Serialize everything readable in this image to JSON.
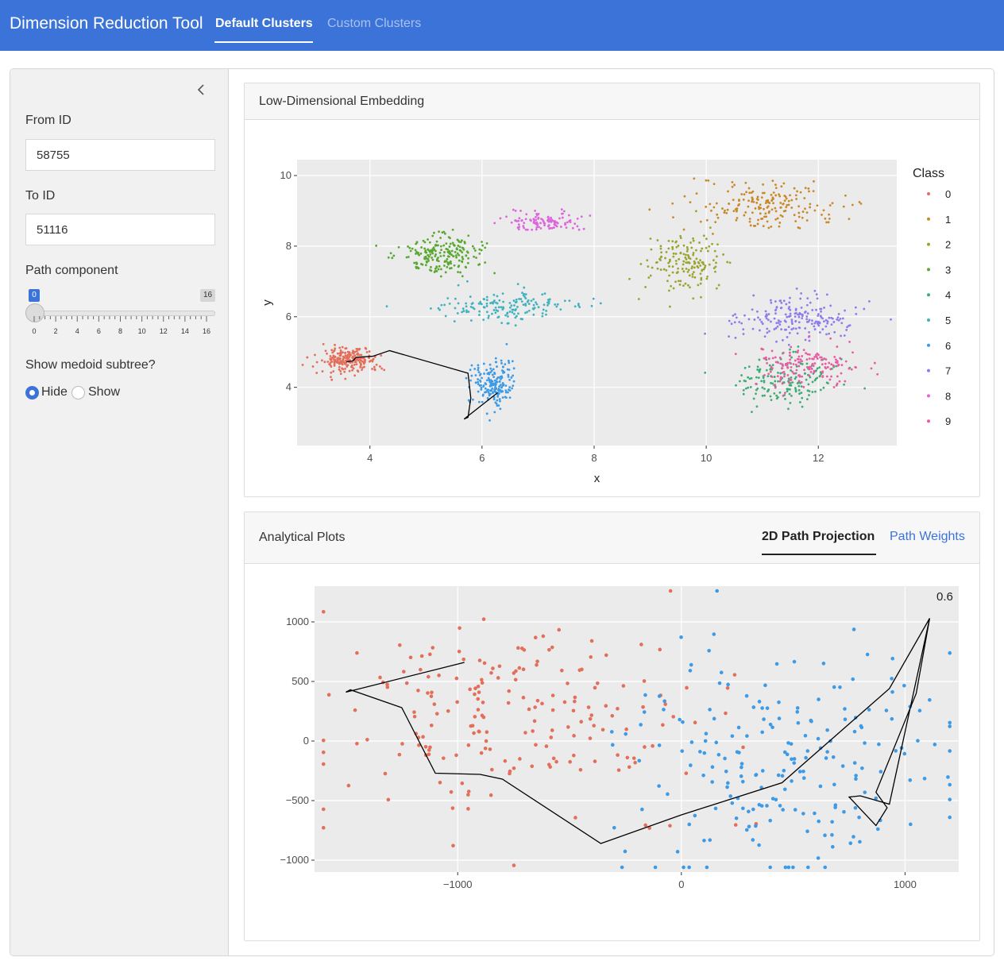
{
  "app": {
    "title": "Dimension Reduction Tool",
    "tabs": [
      {
        "label": "Default Clusters",
        "active": true
      },
      {
        "label": "Custom Clusters",
        "active": false
      }
    ]
  },
  "sidebar": {
    "from_id": {
      "label": "From ID",
      "value": "58755"
    },
    "to_id": {
      "label": "To ID",
      "value": "51116"
    },
    "path_component": {
      "label": "Path component",
      "value": 0,
      "min": 0,
      "max": 16,
      "min_label": "0",
      "max_label": "16",
      "ticks": [
        "0",
        "2",
        "4",
        "6",
        "8",
        "10",
        "12",
        "14",
        "16"
      ]
    },
    "medoid": {
      "label": "Show medoid subtree?",
      "options": [
        "Hide",
        "Show"
      ],
      "selected": "Hide"
    }
  },
  "embedding_card": {
    "title": "Low-Dimensional Embedding"
  },
  "analytical_card": {
    "title": "Analytical Plots",
    "tabs": [
      {
        "label": "2D Path Projection",
        "active": true
      },
      {
        "label": "Path Weights",
        "active": false
      }
    ]
  },
  "colors": {
    "accent": "#3b73d9",
    "plot_bg": "#ebebeb",
    "classes": [
      "#e36f5a",
      "#c9892a",
      "#9ba42f",
      "#5aa831",
      "#3fac75",
      "#40b2bd",
      "#3d9ae6",
      "#8f7ceb",
      "#de66dc",
      "#e85ca2"
    ]
  },
  "chart_data": [
    {
      "type": "scatter",
      "title": "",
      "xlabel": "x",
      "ylabel": "y",
      "xlim": [
        2.7,
        13.4
      ],
      "ylim": [
        2.35,
        10.45
      ],
      "xticks": [
        4,
        6,
        8,
        10,
        12
      ],
      "yticks": [
        4,
        6,
        8,
        10
      ],
      "grid": true,
      "legend": {
        "title": "Class",
        "position": "right",
        "entries": [
          "0",
          "1",
          "2",
          "3",
          "4",
          "5",
          "6",
          "7",
          "8",
          "9"
        ]
      },
      "clusters": [
        {
          "name": "0",
          "center": [
            3.6,
            4.75
          ],
          "spread": [
            0.45,
            0.3
          ],
          "n": 220
        },
        {
          "name": "1",
          "center": [
            11.0,
            9.2
          ],
          "spread": [
            1.1,
            0.55
          ],
          "n": 190
        },
        {
          "name": "2",
          "center": [
            9.6,
            7.5
          ],
          "spread": [
            0.55,
            0.75
          ],
          "n": 160
        },
        {
          "name": "3",
          "center": [
            5.3,
            7.8
          ],
          "spread": [
            0.6,
            0.45
          ],
          "n": 210
        },
        {
          "name": "4",
          "center": [
            11.4,
            4.2
          ],
          "spread": [
            0.9,
            0.6
          ],
          "n": 170
        },
        {
          "name": "5",
          "center": [
            6.5,
            6.3
          ],
          "spread": [
            1.0,
            0.35
          ],
          "n": 160
        },
        {
          "name": "6",
          "center": [
            6.2,
            4.1
          ],
          "spread": [
            0.3,
            0.55
          ],
          "n": 190
        },
        {
          "name": "7",
          "center": [
            11.6,
            5.9
          ],
          "spread": [
            0.9,
            0.55
          ],
          "n": 190
        },
        {
          "name": "8",
          "center": [
            7.1,
            8.7
          ],
          "spread": [
            0.55,
            0.2
          ],
          "n": 110
        },
        {
          "name": "9",
          "center": [
            11.8,
            4.6
          ],
          "spread": [
            0.8,
            0.55
          ],
          "n": 160
        }
      ],
      "path": [
        [
          3.58,
          4.72
        ],
        [
          3.7,
          4.75
        ],
        [
          3.75,
          4.85
        ],
        [
          4.05,
          4.88
        ],
        [
          4.35,
          5.04
        ],
        [
          5.75,
          4.4
        ],
        [
          5.8,
          3.7
        ],
        [
          5.75,
          3.15
        ],
        [
          5.68,
          3.1
        ],
        [
          6.28,
          3.85
        ]
      ]
    },
    {
      "type": "scatter",
      "title": "",
      "xlabel": "",
      "ylabel": "",
      "xlim": [
        -1640,
        1240
      ],
      "ylim": [
        -1100,
        1300
      ],
      "xticks": [
        -1000,
        0,
        1000
      ],
      "yticks": [
        -1000,
        -500,
        0,
        500,
        1000
      ],
      "annotation": "0.6",
      "grid": true,
      "groups": [
        {
          "name": "0",
          "color": "#e36f5a",
          "center": [
            -750,
            180
          ],
          "spread": [
            420,
            430
          ],
          "n": 200
        },
        {
          "name": "6",
          "color": "#3d9ae6",
          "center": [
            480,
            -190
          ],
          "spread": [
            380,
            460
          ],
          "n": 210
        }
      ],
      "path": [
        [
          -970,
          660
        ],
        [
          -1500,
          410
        ],
        [
          -1480,
          430
        ],
        [
          -1250,
          280
        ],
        [
          -1100,
          -270
        ],
        [
          -900,
          -280
        ],
        [
          -800,
          -320
        ],
        [
          -360,
          -860
        ],
        [
          0,
          -620
        ],
        [
          450,
          -350
        ],
        [
          930,
          440
        ],
        [
          1110,
          1030
        ],
        [
          1050,
          400
        ],
        [
          870,
          -430
        ],
        [
          920,
          -560
        ],
        [
          870,
          -710
        ],
        [
          750,
          -470
        ],
        [
          800,
          -460
        ],
        [
          930,
          -530
        ],
        [
          1110,
          1030
        ]
      ]
    }
  ]
}
